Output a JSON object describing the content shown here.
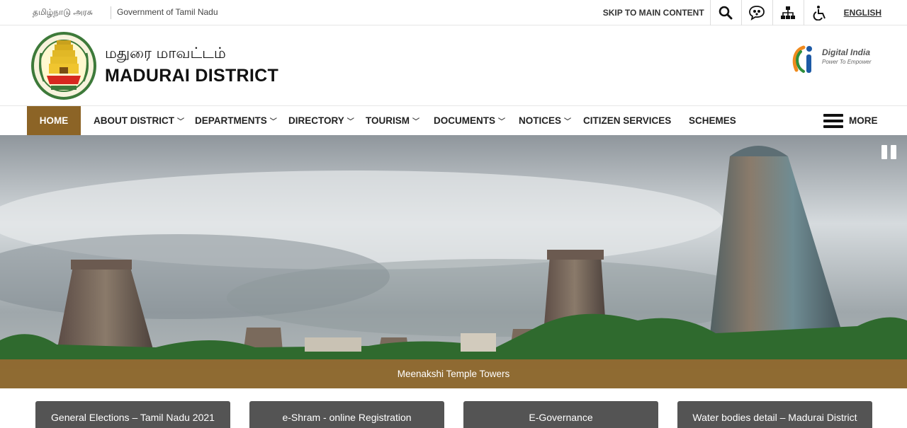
{
  "topbar": {
    "tamil_gov": "தமிழ்நாடு அரசு",
    "gov": "Government of Tamil Nadu",
    "skip": "SKIP TO MAIN CONTENT",
    "language": "ENGLISH",
    "icons": [
      "search-icon",
      "social-icon",
      "sitemap-icon",
      "accessibility-icon"
    ]
  },
  "header": {
    "title_tamil": "மதுரை மாவட்டம்",
    "title_english": "MADURAI DISTRICT",
    "digital_india_title": "Digital India",
    "digital_india_tagline": "Power To Empower"
  },
  "nav": {
    "items": [
      {
        "label": "HOME",
        "dropdown": false
      },
      {
        "label": "ABOUT DISTRICT",
        "dropdown": true
      },
      {
        "label": "DEPARTMENTS",
        "dropdown": true
      },
      {
        "label": "DIRECTORY",
        "dropdown": true
      },
      {
        "label": "TOURISM",
        "dropdown": true
      },
      {
        "label": "DOCUMENTS",
        "dropdown": true
      },
      {
        "label": "NOTICES",
        "dropdown": true
      },
      {
        "label": "CITIZEN SERVICES",
        "dropdown": false
      },
      {
        "label": "SCHEMES",
        "dropdown": false
      }
    ],
    "more": "MORE",
    "chevron": "﹀"
  },
  "banner": {
    "caption": "Meenakshi Temple Towers"
  },
  "quick_links": [
    "General Elections – Tamil Nadu 2021",
    "e-Shram - online Registration",
    "E-Governance",
    "Water bodies detail – Madurai District"
  ],
  "colors": {
    "accent": "#8c6426",
    "quick_link_bg": "#545454"
  }
}
